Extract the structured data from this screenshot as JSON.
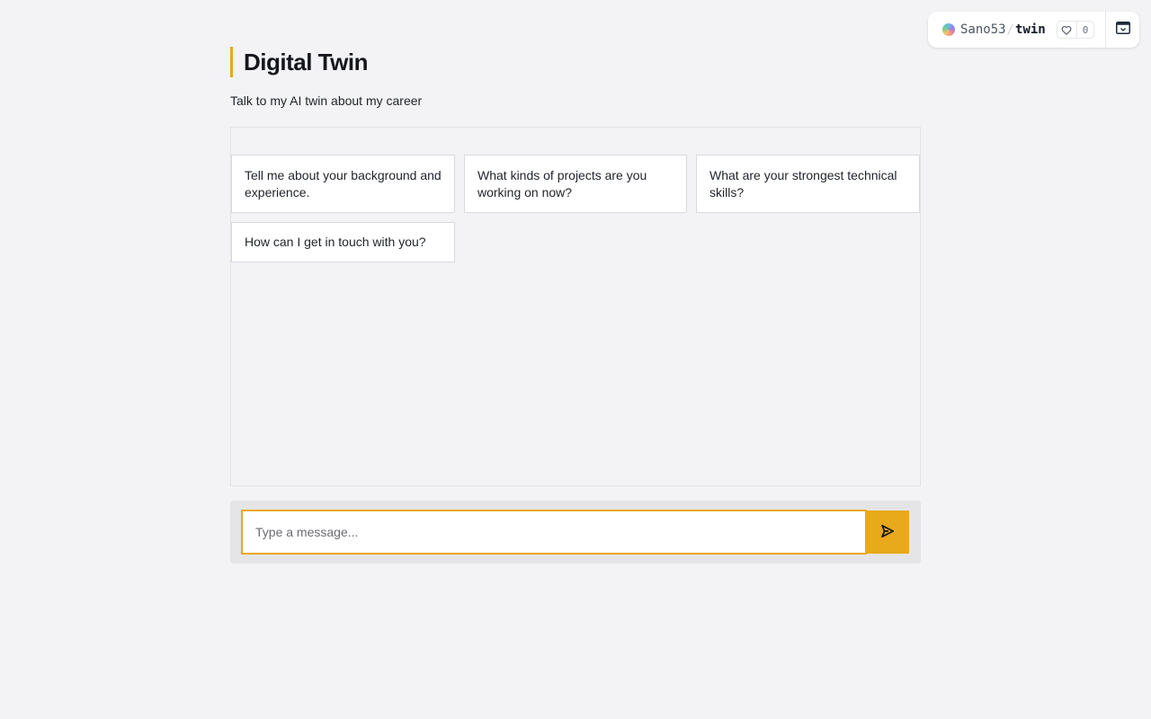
{
  "space": {
    "owner": "Sano53",
    "separator": "/",
    "repo": "twin",
    "likes": "0",
    "icons": {
      "like": "heart-icon",
      "action": "window-collapse-icon"
    }
  },
  "header": {
    "title": "Digital Twin",
    "subtitle": "Talk to my AI twin about my career"
  },
  "suggestions": [
    "Tell me about your background and experience.",
    "What kinds of projects are you working on now?",
    "What are your strongest technical skills?",
    "How can I get in touch with you?"
  ],
  "composer": {
    "placeholder": "Type a message...",
    "value": "",
    "send_icon": "send-icon"
  },
  "colors": {
    "accent": "#e8a91a",
    "background": "#f3f3f5"
  }
}
